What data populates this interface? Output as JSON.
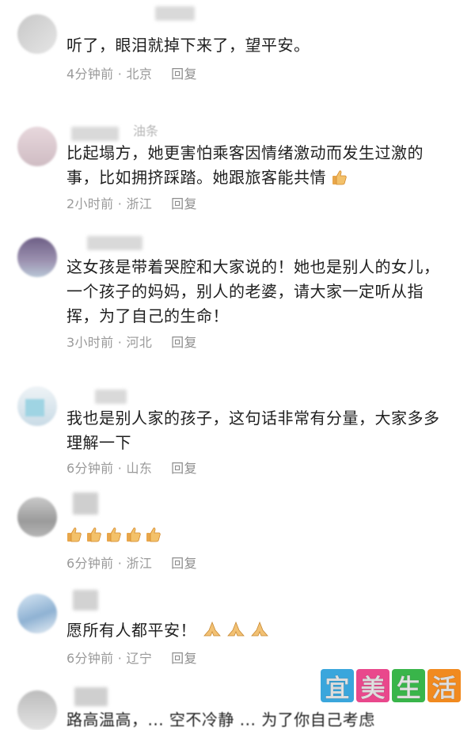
{
  "comments": [
    {
      "text": "听了，眼泪就掉下来了，望平安。",
      "meta_time": "4分钟前 · 北京",
      "reply": "回复"
    },
    {
      "name_fragment": "油条",
      "text": "比起塌方，她更害怕乘客因情绪激动而发生过激的事，比如拥挤踩踏。她跟旅客能共情",
      "meta_time": "2小时前 · 浙江",
      "reply": "回复"
    },
    {
      "text": "这女孩是带着哭腔和大家说的！她也是别人的女儿，一个孩子的妈妈，别人的老婆，请大家一定听从指挥，为了自己的生命！",
      "meta_time": "3小时前 · 河北",
      "reply": "回复"
    },
    {
      "text": "我也是别人家的孩子，这句话非常有分量，大家多多理解一下",
      "meta_time": "6分钟前 · 山东",
      "reply": "回复"
    },
    {
      "text": "",
      "meta_time": "6分钟前 · 浙江",
      "reply": "回复"
    },
    {
      "text": "愿所有人都平安！",
      "meta_time": "6分钟前 · 辽宁",
      "reply": "回复"
    }
  ],
  "watermark": {
    "chars": [
      "宜",
      "美",
      "生",
      "活"
    ],
    "colors": [
      "#3aa6dc",
      "#e9488c",
      "#39b54a",
      "#f18a1f"
    ]
  },
  "bottom_text": "路高温高，... 空不冷静 ... 为了你自己考虑"
}
